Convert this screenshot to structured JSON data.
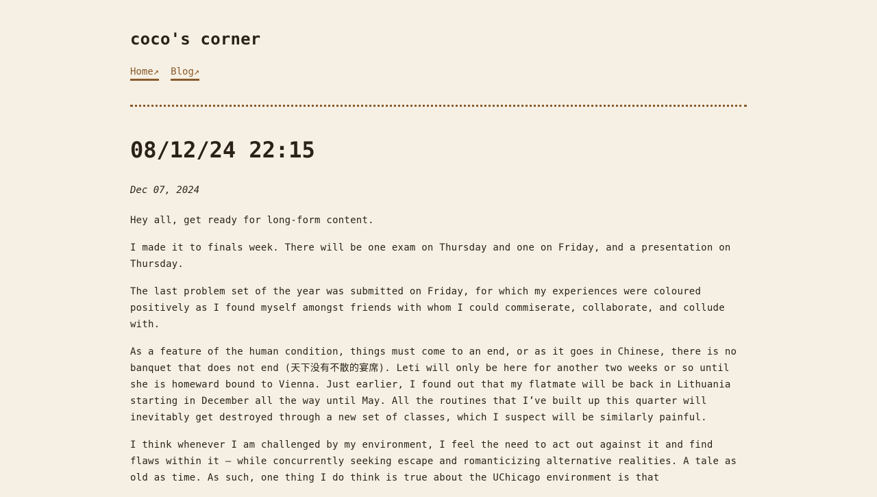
{
  "site": {
    "title": "coco's corner"
  },
  "nav": {
    "items": [
      {
        "label": "Home↗"
      },
      {
        "label": "Blog↗"
      }
    ]
  },
  "post": {
    "title": "08/12/24 22:15",
    "date": "Dec 07, 2024",
    "paragraphs": [
      "Hey all, get ready for long-form content.",
      "I made it to finals week. There will be one exam on Thursday and one on Friday, and a presentation on Thursday.",
      "The last problem set of the year was submitted on Friday, for which my experiences were coloured positively as I found myself amongst friends with whom I could commiserate, collaborate, and collude with.",
      "As a feature of the human condition, things must come to an end, or as it goes in Chinese, there is no banquet that does not end (天下没有不散的宴席). Leti will only be here for another two weeks or so until she is homeward bound to Vienna. Just earlier, I found out that my flatmate will be back in Lithuania starting in December all the way until May. All the routines that I’ve built up this quarter will inevitably get destroyed through a new set of classes, which I suspect will be similarly painful.",
      "I think whenever I am challenged by my environment, I feel the need to act out against it and find flaws within it — while concurrently seeking escape and romanticizing alternative realities. A tale as old as time. As such, one thing I do think is true about the UChicago environment is that"
    ]
  },
  "colors": {
    "background": "#f6f0e4",
    "text": "#2a2119",
    "accent": "#8a5a2b"
  }
}
